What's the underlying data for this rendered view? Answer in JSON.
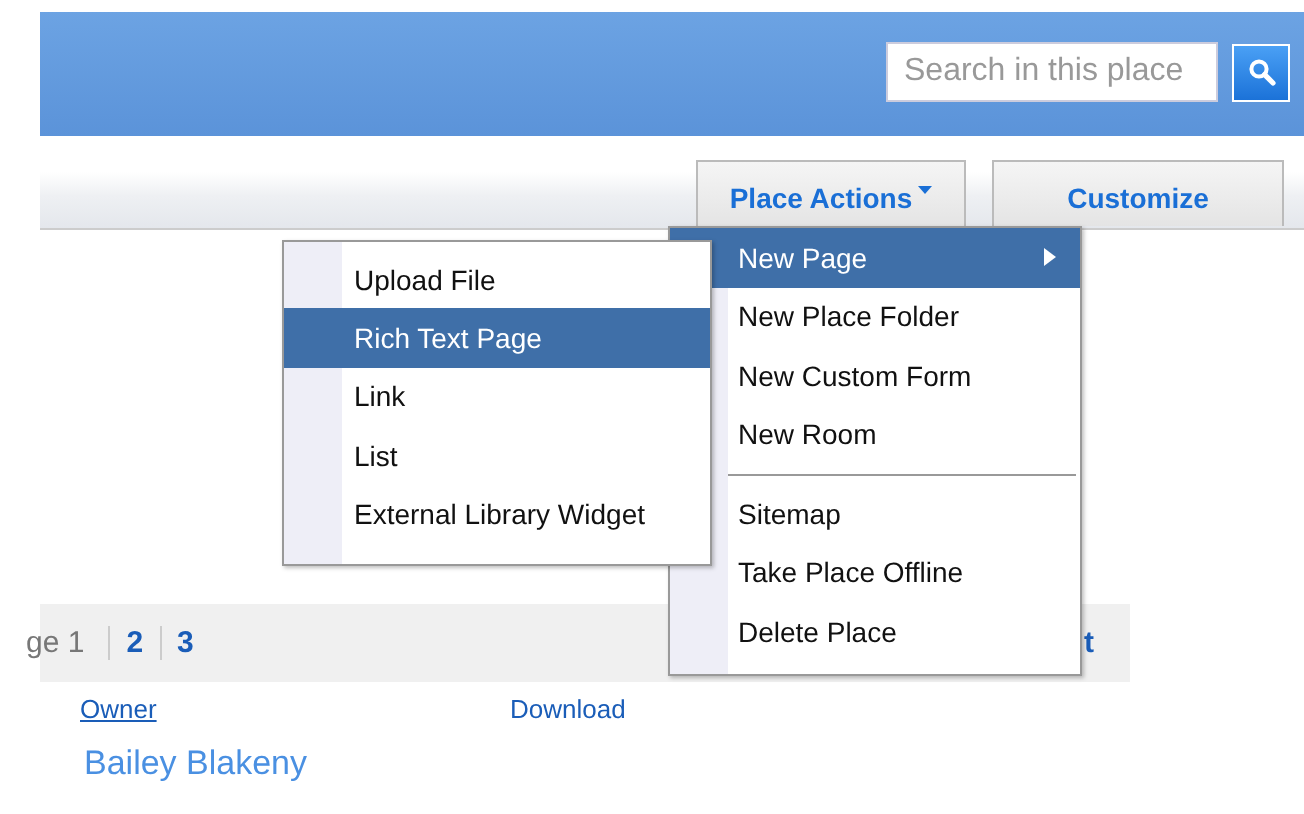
{
  "search": {
    "placeholder": "Search in this place"
  },
  "toolbar": {
    "buttons": [
      {
        "label": "Place Actions",
        "dropdown": true
      },
      {
        "label": "Customize",
        "dropdown": false
      }
    ]
  },
  "menu": {
    "groups": [
      [
        {
          "label": "New Page",
          "selected": true,
          "has_submenu": true
        },
        {
          "label": "New Place Folder",
          "selected": false,
          "has_submenu": false
        },
        {
          "label": "New Custom Form",
          "selected": false,
          "has_submenu": false
        },
        {
          "label": "New Room",
          "selected": false,
          "has_submenu": false
        }
      ],
      [
        {
          "label": "Sitemap",
          "selected": false,
          "has_submenu": false
        },
        {
          "label": "Take Place Offline",
          "selected": false,
          "has_submenu": false
        },
        {
          "label": "Delete Place",
          "selected": false,
          "has_submenu": false
        }
      ]
    ]
  },
  "submenu": {
    "items": [
      {
        "label": "Upload File",
        "selected": false
      },
      {
        "label": "Rich Text Page",
        "selected": true
      },
      {
        "label": "Link",
        "selected": false
      },
      {
        "label": "List",
        "selected": false
      },
      {
        "label": "External Library Widget",
        "selected": false
      }
    ]
  },
  "pager": {
    "current": "ge 1",
    "pages": [
      "2",
      "3"
    ],
    "right_text": "t"
  },
  "columns": [
    "Owner",
    "Download"
  ],
  "rows": [
    {
      "owner": "Bailey Blakeny"
    }
  ]
}
